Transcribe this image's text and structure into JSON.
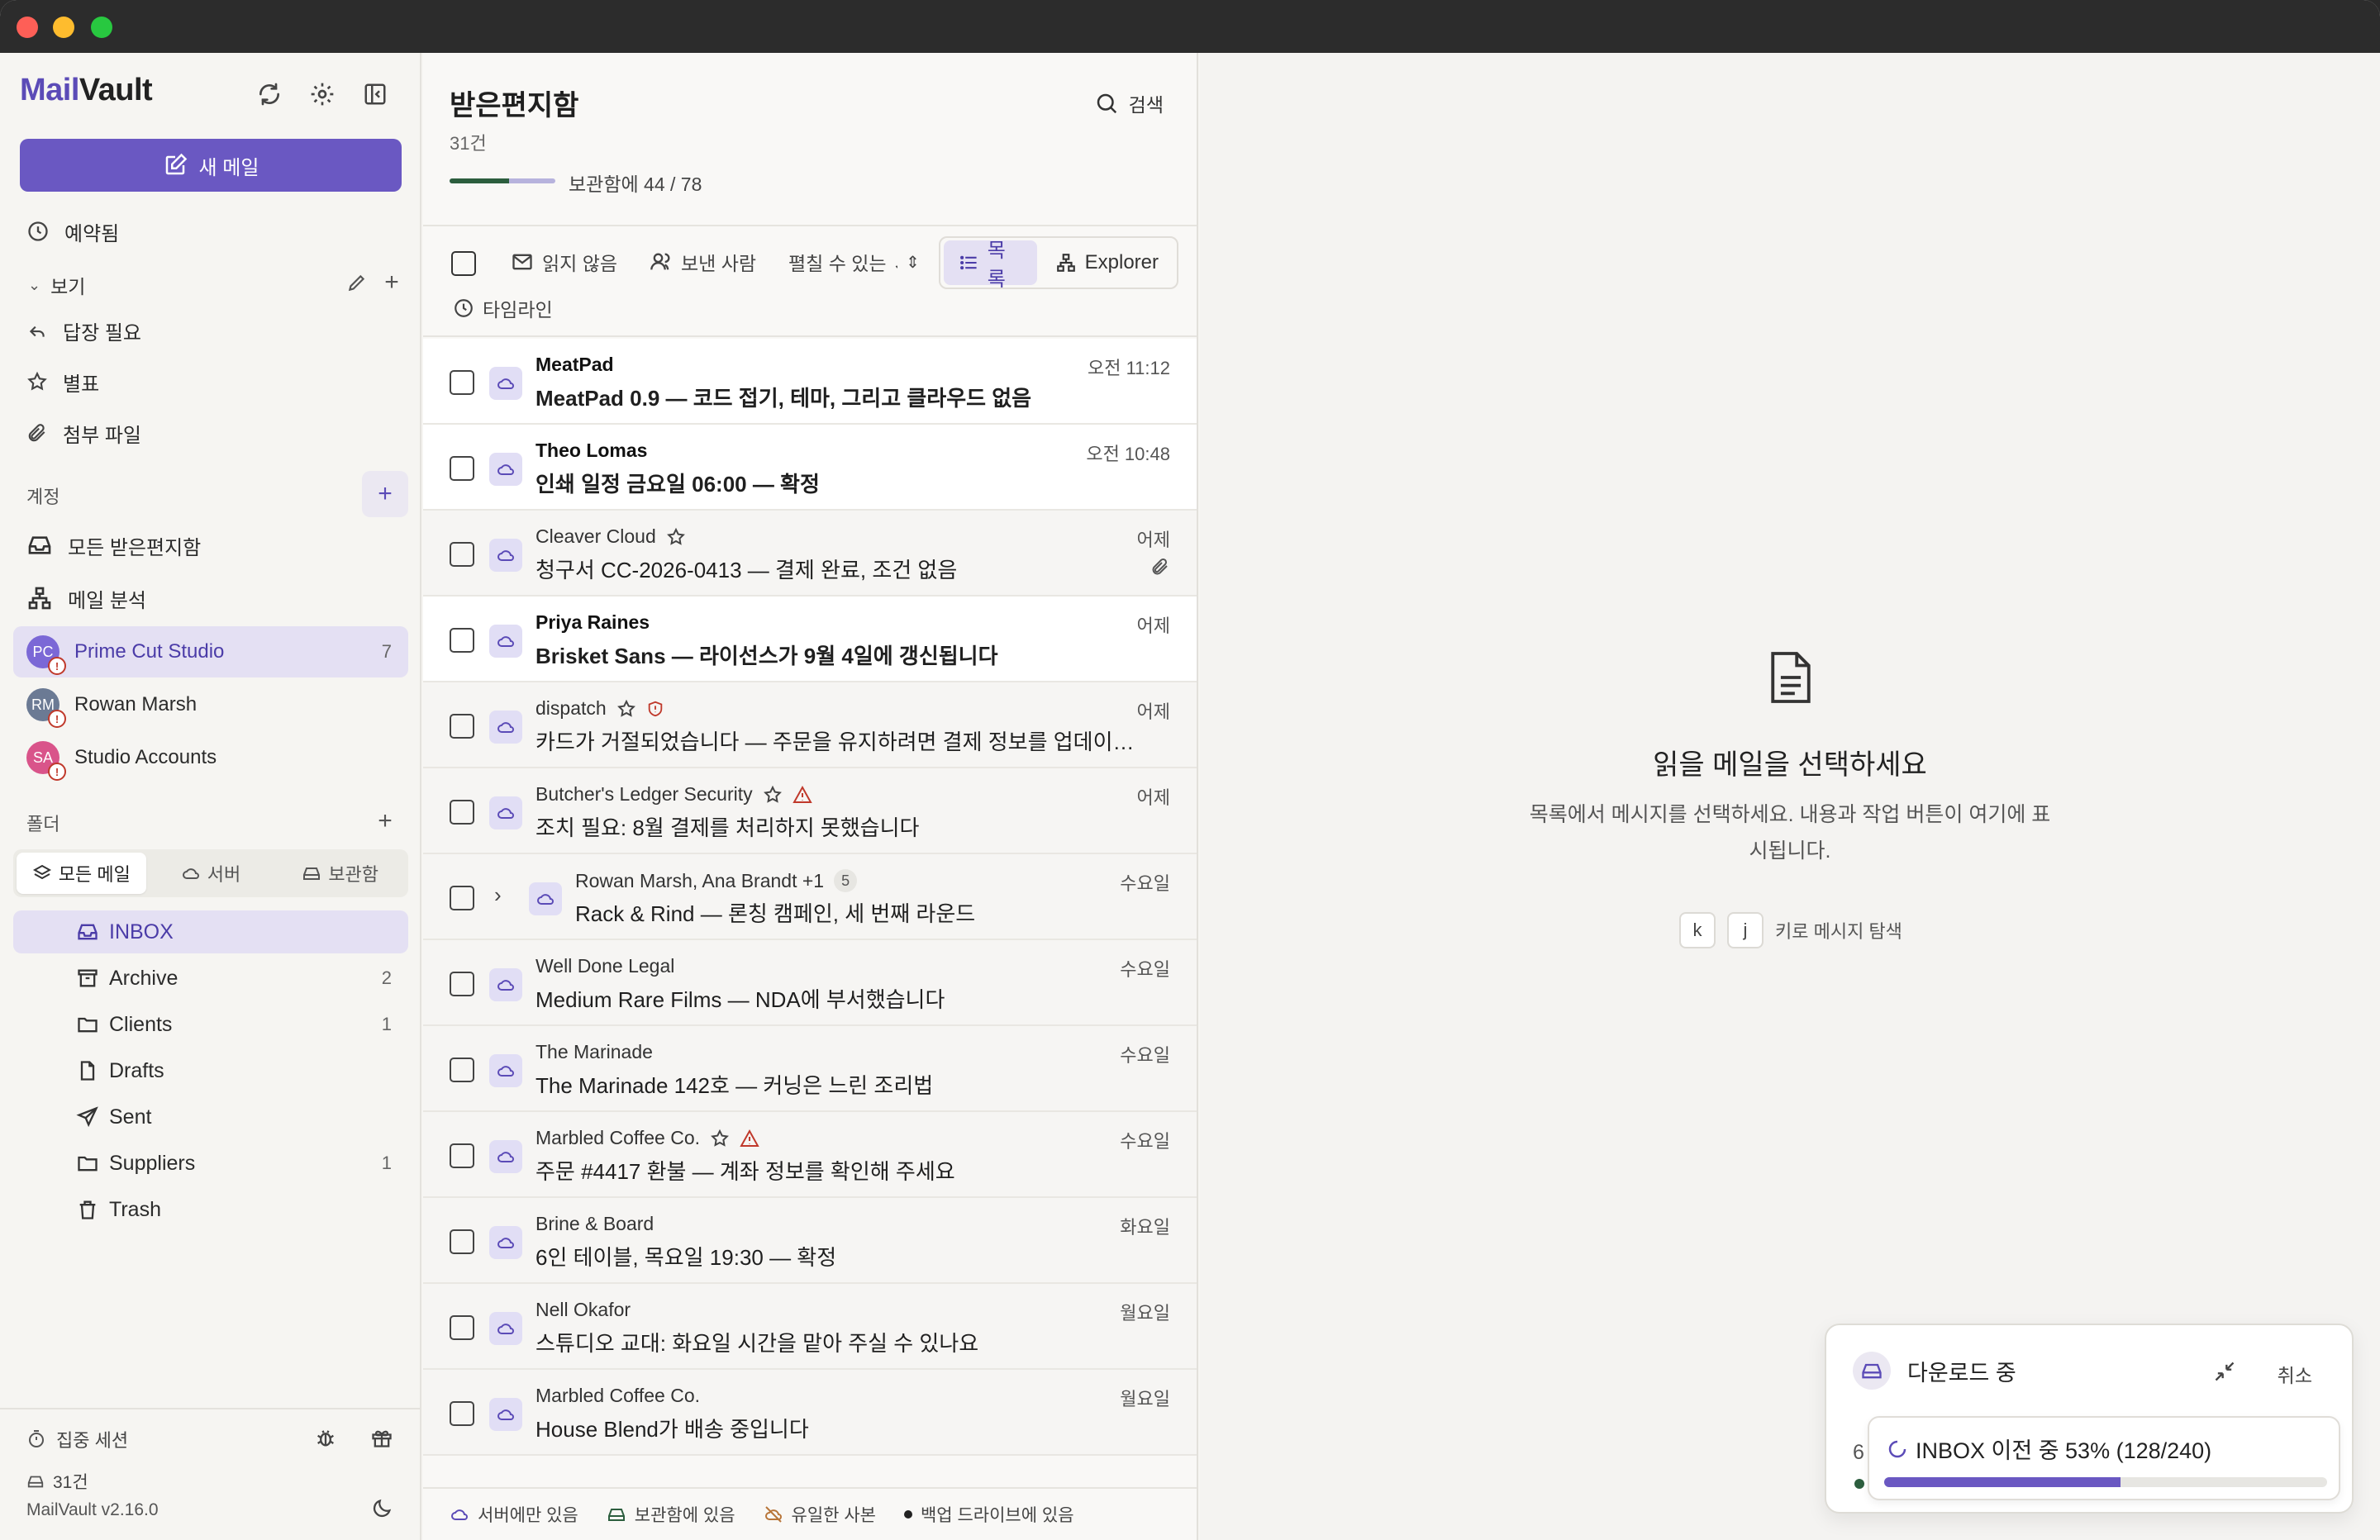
{
  "app": {
    "logo_mail": "Mail",
    "logo_vault": "Vault",
    "new_mail": "새 메일",
    "version": "MailVault v2.16.0"
  },
  "sidebar": {
    "scheduled": "예약됨",
    "views_label": "보기",
    "views": [
      {
        "label": "답장 필요",
        "icon": "reply-icon"
      },
      {
        "label": "별표",
        "icon": "star-icon"
      },
      {
        "label": "첨부 파일",
        "icon": "paperclip-icon"
      }
    ],
    "accounts_label": "계정",
    "all_inbox": "모든 받은편지함",
    "mail_analysis": "메일 분석",
    "accounts": [
      {
        "initials": "PC",
        "name": "Prime Cut Studio",
        "count": "7",
        "color": "#7b68d6",
        "active": true
      },
      {
        "initials": "RM",
        "name": "Rowan Marsh",
        "count": "",
        "color": "#6b7a94",
        "active": false
      },
      {
        "initials": "SA",
        "name": "Studio Accounts",
        "count": "",
        "color": "#d9548a",
        "active": false
      }
    ],
    "folders_label": "폴더",
    "folder_tabs": [
      "모든 메일",
      "서버",
      "보관함"
    ],
    "folders": [
      {
        "name": "INBOX",
        "count": "",
        "icon": "inbox-icon"
      },
      {
        "name": "Archive",
        "count": "2",
        "icon": "archive-icon"
      },
      {
        "name": "Clients",
        "count": "1",
        "icon": "folder-icon"
      },
      {
        "name": "Drafts",
        "count": "",
        "icon": "file-icon"
      },
      {
        "name": "Sent",
        "count": "",
        "icon": "send-icon"
      },
      {
        "name": "Suppliers",
        "count": "1",
        "icon": "folder-icon"
      },
      {
        "name": "Trash",
        "count": "",
        "icon": "trash-icon"
      }
    ],
    "focus_session": "집중 세션",
    "vault_count": "31건"
  },
  "list": {
    "title": "받은편지함",
    "count": "31건",
    "vault_progress_label": "보관함에 44 / 78",
    "vault_progress": 0.564,
    "search": "검색",
    "filters": {
      "unread": "읽지 않음",
      "sender": "보낸 사람",
      "expandable": "펼칠 수 있는 ⌄",
      "timeline": "타임라인"
    },
    "view_list": "목록",
    "view_explorer": "Explorer",
    "rows": [
      {
        "sender": "MeatPad",
        "subject": "MeatPad 0.9 — 코드 접기, 테마, 그리고 클라우드 없음",
        "time": "오전 11:12",
        "unread": true
      },
      {
        "sender": "Theo Lomas",
        "subject": "인쇄 일정 금요일 06:00 — 확정",
        "time": "오전 10:48",
        "unread": true
      },
      {
        "sender": "Cleaver Cloud",
        "subject": "청구서 CC-2026-0413 — 결제 완료, 조건 없음",
        "time": "어제",
        "unread": false,
        "star": true,
        "attachment": true
      },
      {
        "sender": "Priya Raines",
        "subject": "Brisket Sans — 라이선스가 9월 4일에 갱신됩니다",
        "time": "어제",
        "unread": true
      },
      {
        "sender": "dispatch",
        "subject": "카드가 거절되었습니다 — 주문을 유지하려면 결제 정보를 업데이트하세요",
        "time": "어제",
        "unread": false,
        "star": true,
        "shield": true
      },
      {
        "sender": "Butcher's Ledger Security",
        "subject": "조치 필요: 8월 결제를 처리하지 못했습니다",
        "time": "어제",
        "unread": false,
        "star": true,
        "warning": true
      },
      {
        "sender": "Rowan Marsh, Ana Brandt +1",
        "subject": "Rack & Rind — 론칭 캠페인, 세 번째 라운드",
        "time": "수요일",
        "unread": false,
        "thread": "5"
      },
      {
        "sender": "Well Done Legal",
        "subject": "Medium Rare Films — NDA에 부서했습니다",
        "time": "수요일",
        "unread": false
      },
      {
        "sender": "The Marinade",
        "subject": "The Marinade 142호 — 커닝은 느린 조리법",
        "time": "수요일",
        "unread": false
      },
      {
        "sender": "Marbled Coffee Co.",
        "subject": "주문 #4417 환불 — 계좌 정보를 확인해 주세요",
        "time": "수요일",
        "unread": false,
        "star": true,
        "warning": true
      },
      {
        "sender": "Brine & Board",
        "subject": "6인 테이블, 목요일 19:30 — 확정",
        "time": "화요일",
        "unread": false
      },
      {
        "sender": "Nell Okafor",
        "subject": "스튜디오 교대: 화요일 시간을 맡아 주실 수 있나요",
        "time": "월요일",
        "unread": false
      },
      {
        "sender": "Marbled Coffee Co.",
        "subject": "House Blend가 배송 중입니다",
        "time": "월요일",
        "unread": false
      }
    ],
    "legend": [
      "서버에만 있음",
      "보관함에 있음",
      "유일한 사본",
      "백업 드라이브에 있음"
    ]
  },
  "reader": {
    "empty_title": "읽을 메일을 선택하세요",
    "empty_desc": "목록에서 메시지를 선택하세요. 내용과 작업 버튼이 여기에 표시됩니다.",
    "key_k": "k",
    "key_j": "j",
    "key_hint": "키로 메시지 탐색"
  },
  "download": {
    "title": "다운로드 중",
    "cancel": "취소",
    "behind_text": "6",
    "progress_text": "INBOX 이전 중 53% (128/240)",
    "progress": 0.533
  },
  "colors": {
    "accent": "#6a58c2",
    "accent_soft": "#e4e0f3",
    "vault_green": "#2c5e3e"
  }
}
